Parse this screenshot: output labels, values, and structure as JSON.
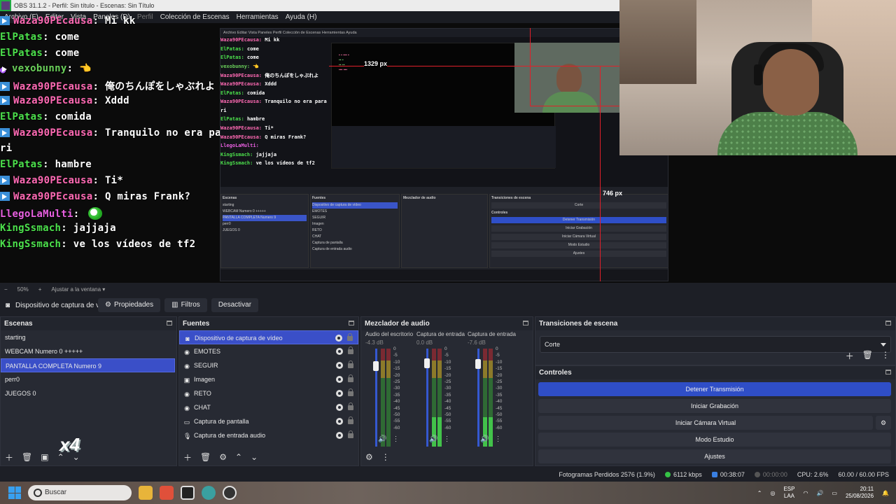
{
  "window": {
    "title": "OBS 31.1.2 - Perfil: Sin título - Escenas: Sin Título",
    "menu": [
      "Archivo (F)",
      "Editar",
      "Vista",
      "Paneles (D)",
      "Perfil",
      "Colección de Escenas",
      "Herramientas",
      "Ayuda (H)"
    ]
  },
  "chat": [
    {
      "user": "Waza90PEcausa",
      "color": "#ff6ab4",
      "badge": "arrow",
      "text": "Mi kk"
    },
    {
      "user": "ElPatas",
      "color": "#4ce04c",
      "badge": "",
      "text": "come"
    },
    {
      "user": "ElPatas",
      "color": "#4ce04c",
      "badge": "",
      "text": "come"
    },
    {
      "user": "vexobunny",
      "color": "#6ad05a",
      "badge": "mic",
      "text": "👈"
    },
    {
      "user": "Waza90PEcausa",
      "color": "#ff6ab4",
      "badge": "arrow",
      "text": "俺のちんぽをしゃぶれよ"
    },
    {
      "user": "Waza90PEcausa",
      "color": "#ff6ab4",
      "badge": "arrow",
      "text": "Xddd"
    },
    {
      "user": "ElPatas",
      "color": "#4ce04c",
      "badge": "",
      "text": "comida"
    },
    {
      "user": "Waza90PEcausa",
      "color": "#ff6ab4",
      "badge": "arrow",
      "text": "Tranquilo no era para"
    },
    {
      "user": "",
      "color": "#ffffff",
      "badge": "",
      "text": "ri"
    },
    {
      "user": "ElPatas",
      "color": "#4ce04c",
      "badge": "",
      "text": "hambre"
    },
    {
      "user": "Waza90PEcausa",
      "color": "#ff6ab4",
      "badge": "arrow",
      "text": "Ti*"
    },
    {
      "user": "Waza90PEcausa",
      "color": "#ff6ab4",
      "badge": "arrow",
      "text": "Q miras Frank?"
    },
    {
      "user": "LlegoLaMulti",
      "color": "#e860e0",
      "badge": "",
      "text": ""
    },
    {
      "user": "KingSsmach",
      "color": "#4ce04c",
      "badge": "",
      "text": "jajjaja"
    },
    {
      "user": "KingSsmach",
      "color": "#4ce04c",
      "badge": "",
      "text": "ve los vídeos de tf2"
    }
  ],
  "preview": {
    "px_top": "1329 px",
    "px_side": "746 px",
    "nested_menu": "Archivo  Editar  Vista  Paneles  Perfil  Colección de Escenas  Herramientas  Ayuda",
    "nested_overlay": "x4"
  },
  "zoom": {
    "minus": "−",
    "value": "50%",
    "plus": "+",
    "fit": "Ajustar a la ventana"
  },
  "source_toolbar": {
    "source_name": "Dispositivo de captura de v",
    "properties": "Propiedades",
    "filters": "Filtros",
    "deactivate": "Desactivar"
  },
  "scenes": {
    "title": "Escenas",
    "items": [
      "starting",
      "WEBCAM Numero 0 +++++",
      "PANTALLA COMPLETA Numero 9",
      "perr0",
      "JUEGOS 0"
    ],
    "selected_index": 2,
    "overlay": "x4"
  },
  "sources": {
    "title": "Fuentes",
    "items": [
      {
        "label": "Dispositivo de captura de vídeo",
        "icon": "camera-icon"
      },
      {
        "label": "EMOTES",
        "icon": "globe-icon"
      },
      {
        "label": "SEGUIR",
        "icon": "globe-icon"
      },
      {
        "label": "Imagen",
        "icon": "image-icon"
      },
      {
        "label": "RETO",
        "icon": "globe-icon"
      },
      {
        "label": "CHAT",
        "icon": "globe-icon"
      },
      {
        "label": "Captura de pantalla",
        "icon": "monitor-icon"
      },
      {
        "label": "Captura de entrada audio",
        "icon": "mic-icon"
      }
    ],
    "selected_index": 0
  },
  "mixer": {
    "title": "Mezclador de audio",
    "channels": [
      {
        "name": "Audio del escritorio",
        "db": "-4.3 dB",
        "level": 0.25
      },
      {
        "name": "Captura de entrada",
        "db": "0.0 dB",
        "level": 0.6
      },
      {
        "name": "Captura de entrada",
        "db": "-7.6 dB",
        "level": 0.55
      }
    ],
    "ticks": [
      "0",
      "-5",
      "-10",
      "-15",
      "-20",
      "-25",
      "-30",
      "-35",
      "-40",
      "-45",
      "-50",
      "-55",
      "-60"
    ]
  },
  "transitions": {
    "title": "Transiciones de escena",
    "selected": "Corte"
  },
  "controls": {
    "title": "Controles",
    "buttons": [
      "Detener Transmisión",
      "Iniciar Grabación",
      "Iniciar Cámara Virtual",
      "Modo Estudio",
      "Ajustes"
    ]
  },
  "status": {
    "dropped": "Fotogramas Perdidos 2576 (1.9%)",
    "bitrate": "6112 kbps",
    "stream_time": "00:38:07",
    "rec_time": "00:00:00",
    "cpu": "CPU: 2.6%",
    "fps": "60.00 / 60.00 FPS"
  },
  "taskbar": {
    "search": "Buscar",
    "lang1": "ESP",
    "lang2": "LAA",
    "time": "20:11",
    "date": "25/08/2026"
  },
  "colors": {
    "accent": "#3a4fc8",
    "stream_button": "#2f4ec7",
    "marker_red": "#e0202a"
  }
}
